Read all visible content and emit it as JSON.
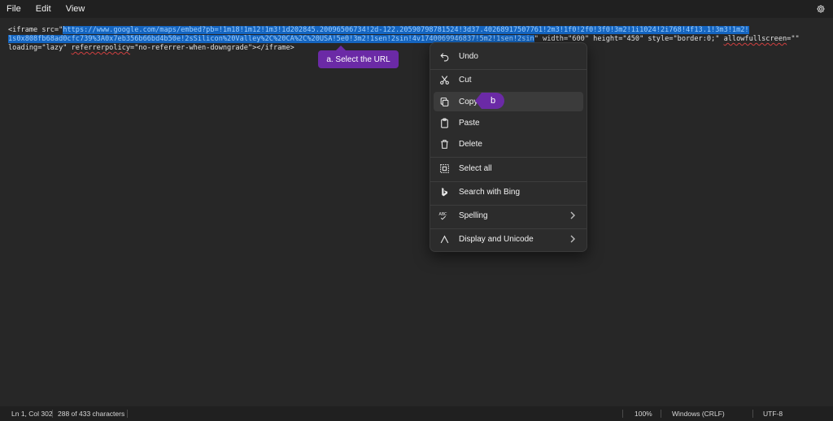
{
  "menubar": {
    "items": [
      "File",
      "Edit",
      "View"
    ]
  },
  "icons": {
    "settings": "gear-icon",
    "undo": "undo-icon",
    "cut": "scissors-icon",
    "copy": "copy-icon",
    "paste": "clipboard-icon",
    "delete": "trash-icon",
    "select_all": "select-all-icon",
    "search_bing": "bing-icon",
    "spelling": "spell-check-icon",
    "unicode": "caret-icon"
  },
  "editor": {
    "line1_pre": "<iframe src=\"",
    "line1_sel": "https://www.google.com/maps/embed?pb=!1m18!1m12!1m3!1d202845.20096506734!2d-122.20590798781524!3d37.40268917507761!2m3!1f0!2f0!3f0!3m2!1i1024!2i768!4f13.1!3m3!1m2!",
    "line2_sel": "1s0x808fb68ad0cfc739%3A0x7eb356b66bd4b50e!2sSilicon%20Valley%2C%20CA%2C%20USA!5e0!3m2!1sen!2sin!4v1740069946837!5m2!1sen!2sin",
    "line2_post": "\" width=\"600\" height=\"450\" style=\"border:0;\" ",
    "line2_attr": "allowfullscreen",
    "line2_end": "=\"\"",
    "line3_pre": "loading=\"lazy\" ",
    "line3_attr": "referrerpolicy",
    "line3_post": "=\"no-referrer-when-downgrade\"></iframe>"
  },
  "callouts": {
    "a": "a. Select the URL",
    "b": "b"
  },
  "context_menu": {
    "undo": "Undo",
    "cut": "Cut",
    "copy": "Copy",
    "paste": "Paste",
    "delete": "Delete",
    "select_all": "Select all",
    "search_bing": "Search with Bing",
    "spelling": "Spelling",
    "unicode": "Display and Unicode"
  },
  "status": {
    "position": "Ln 1, Col 302",
    "count": "288 of 433 characters",
    "zoom": "100%",
    "line_ending": "Windows (CRLF)",
    "encoding": "UTF-8"
  },
  "colors": {
    "selection": "#1565c0",
    "callout": "#6b2aa6",
    "editor_bg": "#272727",
    "menu_bg": "#2c2c2c"
  }
}
